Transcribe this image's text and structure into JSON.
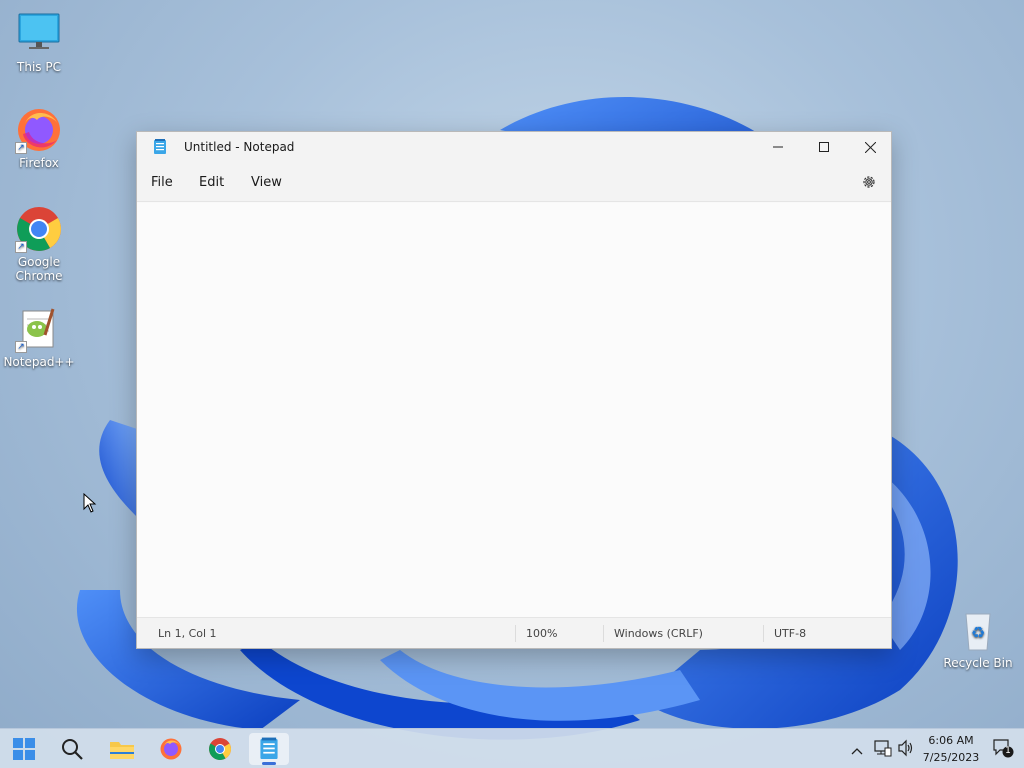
{
  "desktop": {
    "icons": [
      {
        "label": "This PC",
        "icon": "monitor-icon"
      },
      {
        "label": "Firefox",
        "icon": "firefox-icon"
      },
      {
        "label": "Google Chrome",
        "icon": "chrome-icon"
      },
      {
        "label": "Notepad++",
        "icon": "notepadpp-icon"
      }
    ],
    "recycle_bin": {
      "label": "Recycle Bin",
      "icon": "recycle-bin-icon"
    }
  },
  "notepad": {
    "title": "Untitled - Notepad",
    "menu": [
      "File",
      "Edit",
      "View"
    ],
    "content": "",
    "status": {
      "position": "Ln 1, Col 1",
      "zoom": "100%",
      "line_ending": "Windows (CRLF)",
      "encoding": "UTF-8"
    }
  },
  "taskbar": {
    "apps": [
      "start-icon",
      "search-icon",
      "file-explorer-icon",
      "firefox-icon",
      "chrome-icon",
      "notepad-icon"
    ],
    "active_app": "notepad-icon",
    "tray": {
      "time": "6:06 AM",
      "date": "7/25/2023",
      "notification_count": "1"
    }
  },
  "colors": {
    "accent": "#3a6fd8",
    "wallpaper_blue": "#1e5be0"
  }
}
